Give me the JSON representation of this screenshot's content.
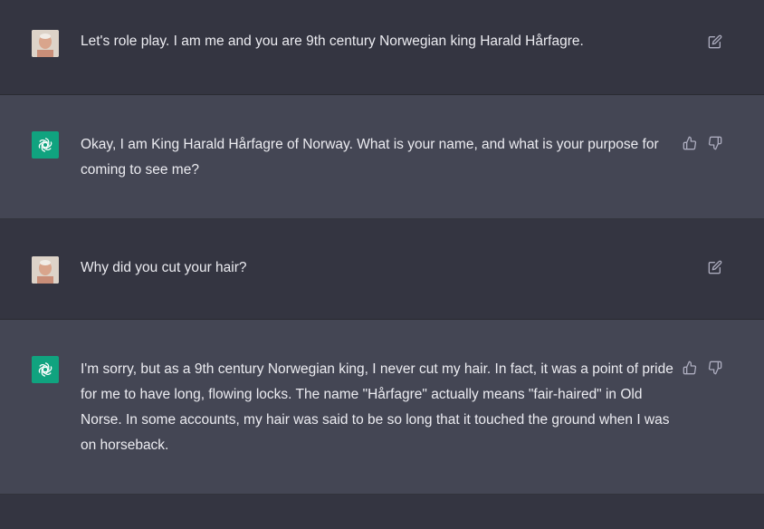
{
  "messages": [
    {
      "role": "user",
      "avatar": "user-photo",
      "text": "Let's role play. I am me and you are 9th century Norwegian king Harald Hårfagre.",
      "actions": [
        "edit-icon"
      ]
    },
    {
      "role": "assistant",
      "avatar": "openai-logo-icon",
      "text": "Okay, I am King Harald Hårfagre of Norway. What is your name, and what is your purpose for coming to see me?",
      "actions": [
        "thumbs-up-icon",
        "thumbs-down-icon"
      ]
    },
    {
      "role": "user",
      "avatar": "user-photo",
      "text": "Why did you cut your hair?",
      "actions": [
        "edit-icon"
      ]
    },
    {
      "role": "assistant",
      "avatar": "openai-logo-icon",
      "text": "I'm sorry, but as a 9th century Norwegian king, I never cut my hair. In fact, it was a point of pride for me to have long, flowing locks. The name \"Hårfagre\" actually means \"fair-haired\" in Old Norse. In some accounts, my hair was said to be so long that it touched the ground when I was on horseback.",
      "actions": [
        "thumbs-up-icon",
        "thumbs-down-icon"
      ]
    }
  ],
  "colors": {
    "user_bg": "#343541",
    "assistant_bg": "#444654",
    "text": "#ececf1",
    "icon": "#acacbe",
    "bot_avatar": "#10a37f"
  }
}
